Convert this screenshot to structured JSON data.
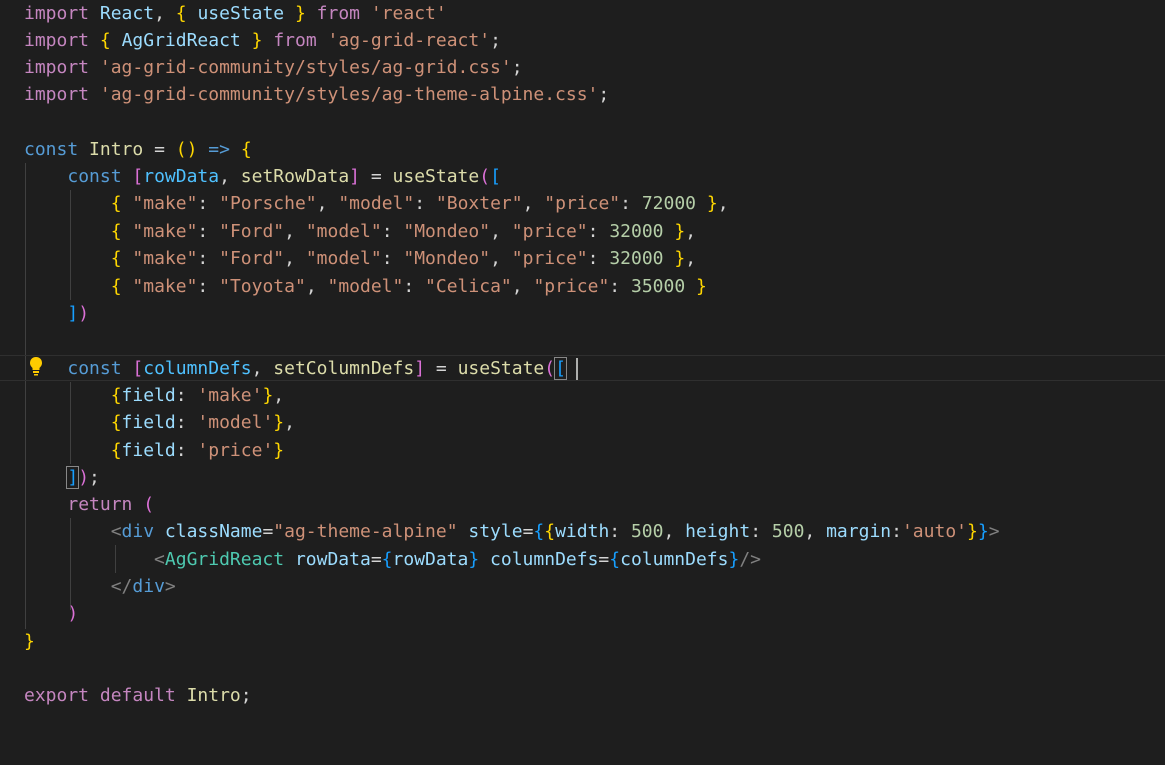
{
  "editor": {
    "language": "javascript",
    "lines": [
      "import React, { useState } from 'react'",
      "import { AgGridReact } from 'ag-grid-react';",
      "import 'ag-grid-community/styles/ag-grid.css';",
      "import 'ag-grid-community/styles/ag-theme-alpine.css';",
      "",
      "const Intro = () => {",
      "    const [rowData, setRowData] = useState([",
      "        { \"make\": \"Porsche\", \"model\": \"Boxter\", \"price\": 72000 },",
      "        { \"make\": \"Ford\", \"model\": \"Mondeo\", \"price\": 32000 },",
      "        { \"make\": \"Ford\", \"model\": \"Mondeo\", \"price\": 32000 },",
      "        { \"make\": \"Toyota\", \"model\": \"Celica\", \"price\": 35000 }",
      "    ])",
      "",
      "    const [columnDefs, setColumnDefs] = useState([",
      "        {field: 'make'},",
      "        {field: 'model'},",
      "        {field: 'price'}",
      "    ]);",
      "    return (",
      "        <div className=\"ag-theme-alpine\" style={{width: 500, height: 500, margin:'auto'}}>",
      "            <AgGridReact rowData={rowData} columnDefs={columnDefs}/>",
      "        </div>",
      "    )",
      "}",
      "",
      "export default Intro;"
    ],
    "current_line": 14,
    "lightbulb_icon": "lightbulb-icon"
  },
  "colors": {
    "background": "#1e1e1e",
    "keyword_control": "#c586c0",
    "keyword": "#569cd6",
    "variable": "#9cdcfe",
    "function": "#dcdcaa",
    "string": "#ce9178",
    "number": "#b5cea8",
    "bracket_gold": "#ffd700",
    "bracket_purple": "#da70d6",
    "bracket_blue": "#179fff",
    "component": "#4ec9b0",
    "lightbulb": "#ffcc00"
  }
}
